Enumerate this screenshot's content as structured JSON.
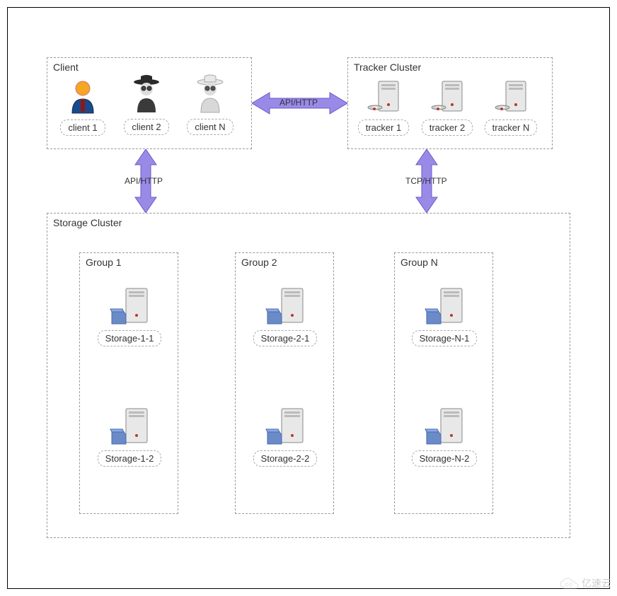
{
  "diagram": {
    "client_box": {
      "title": "Client"
    },
    "tracker_box": {
      "title": "Tracker Cluster"
    },
    "storage_box": {
      "title": "Storage Cluster"
    },
    "clients": [
      {
        "label": "client 1"
      },
      {
        "label": "client 2"
      },
      {
        "label": "client N"
      }
    ],
    "trackers": [
      {
        "label": "tracker 1"
      },
      {
        "label": "tracker 2"
      },
      {
        "label": "tracker N"
      }
    ],
    "groups": [
      {
        "title": "Group 1",
        "storages": [
          {
            "label": "Storage-1-1"
          },
          {
            "label": "Storage-1-2"
          }
        ]
      },
      {
        "title": "Group 2",
        "storages": [
          {
            "label": "Storage-2-1"
          },
          {
            "label": "Storage-2-2"
          }
        ]
      },
      {
        "title": "Group N",
        "storages": [
          {
            "label": "Storage-N-1"
          },
          {
            "label": "Storage-N-2"
          }
        ]
      }
    ],
    "arrows": {
      "client_tracker": "API/HTTP",
      "client_storage": "API/HTTP",
      "tracker_storage": "TCP/HTTP"
    },
    "watermark": "亿速云"
  }
}
